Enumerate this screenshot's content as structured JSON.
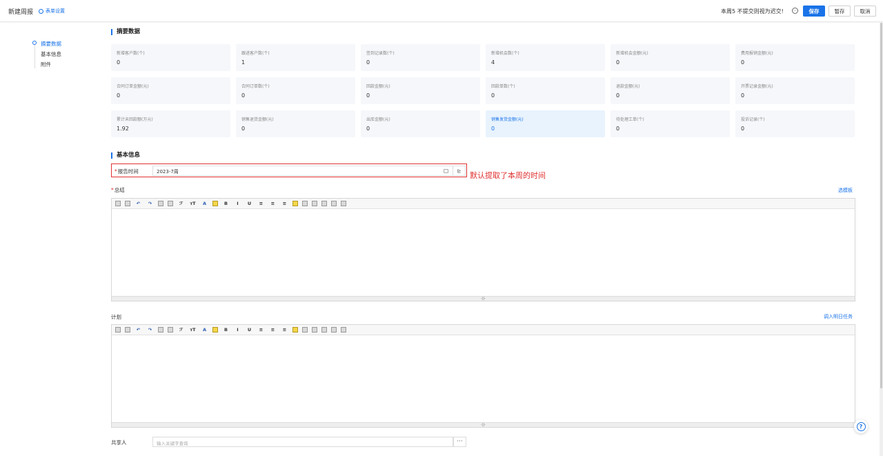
{
  "header": {
    "title": "新建周报",
    "settings_label": "表单设置",
    "notice": "本周5 不提交则视为迟交!",
    "save_label": "保存",
    "temp_save_label": "暂存",
    "cancel_label": "取消"
  },
  "nav": {
    "items": [
      "摘要数据",
      "基本信息",
      "附件"
    ]
  },
  "summary": {
    "title": "摘要数据",
    "cards": [
      {
        "label": "新增客户数(个)",
        "value": "0"
      },
      {
        "label": "跟进客户数(个)",
        "value": "1"
      },
      {
        "label": "签到记录数(个)",
        "value": "0"
      },
      {
        "label": "新增机会数(个)",
        "value": "4"
      },
      {
        "label": "新增机会金额(元)",
        "value": "0"
      },
      {
        "label": "费用报销金额(元)",
        "value": "0"
      },
      {
        "label": "合同订单金额(元)",
        "value": "0"
      },
      {
        "label": "合同订单数(个)",
        "value": "0"
      },
      {
        "label": "回款金额(元)",
        "value": "0"
      },
      {
        "label": "回款单数(个)",
        "value": "0"
      },
      {
        "label": "退款金额(元)",
        "value": "0"
      },
      {
        "label": "开票记录金额(元)",
        "value": "0"
      },
      {
        "label": "累计未回款额(万元)",
        "value": "1.92"
      },
      {
        "label": "销售退货金额(元)",
        "value": "0"
      },
      {
        "label": "出库金额(元)",
        "value": "0"
      },
      {
        "label": "销售发货金额(元)",
        "value": "0"
      },
      {
        "label": "待处理工单(个)",
        "value": "0"
      },
      {
        "label": "投诉记录(个)",
        "value": "0"
      }
    ]
  },
  "basic": {
    "title": "基本信息",
    "report_time_label": "报告时间",
    "report_time_value": "2023-7周",
    "annotation": "默认提取了本周的时间",
    "summary_label": "总结",
    "template_link": "选模板",
    "plan_label": "计划",
    "import_link": "调入明日任务",
    "share_label": "共享人",
    "share_placeholder": "输入关键字查询",
    "share_btn": "···",
    "date_btn": "⊵",
    "grip": "-||-"
  },
  "colors": {
    "accent": "#1a73e8",
    "annotation": "#e03030"
  }
}
